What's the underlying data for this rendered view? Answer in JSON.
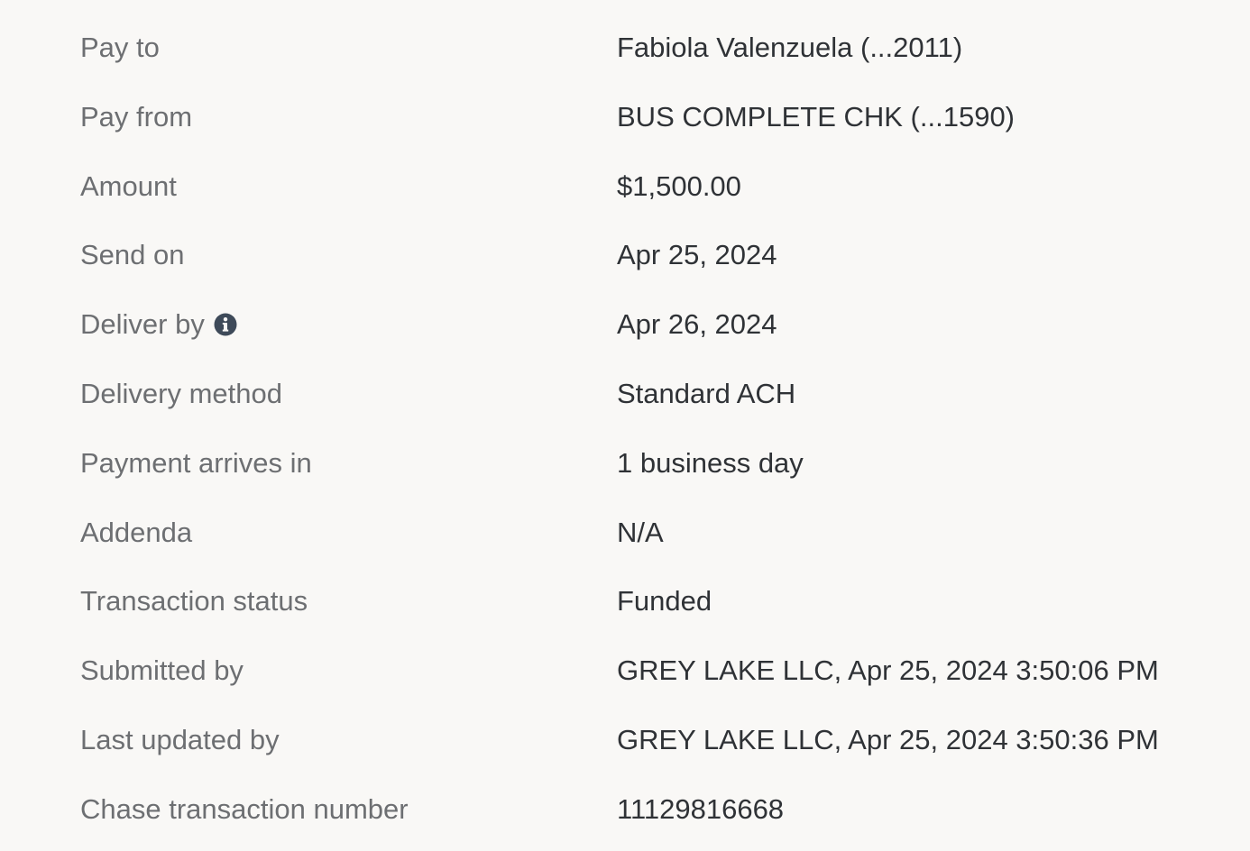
{
  "payment_details": {
    "rows": [
      {
        "label": "Pay to",
        "value": "Fabiola Valenzuela (...2011)"
      },
      {
        "label": "Pay from",
        "value": "BUS COMPLETE CHK (...1590)"
      },
      {
        "label": "Amount",
        "value": "$1,500.00"
      },
      {
        "label": "Send on",
        "value": "Apr 25, 2024"
      },
      {
        "label": "Deliver by",
        "value": "Apr 26, 2024",
        "icon": "info-icon"
      },
      {
        "label": "Delivery method",
        "value": "Standard ACH"
      },
      {
        "label": "Payment arrives in",
        "value": "1 business day"
      },
      {
        "label": "Addenda",
        "value": "N/A"
      },
      {
        "label": "Transaction status",
        "value": "Funded"
      },
      {
        "label": "Submitted by",
        "value": "GREY LAKE LLC, Apr 25, 2024 3:50:06 PM"
      },
      {
        "label": "Last updated by",
        "value": "GREY LAKE LLC, Apr 25, 2024 3:50:36 PM"
      },
      {
        "label": "Chase transaction number",
        "value": "11129816668"
      }
    ]
  },
  "colors": {
    "background": "#f9f8f6",
    "label_text": "#6d6f72",
    "value_text": "#2f3236",
    "icon": "#3e4a59"
  }
}
